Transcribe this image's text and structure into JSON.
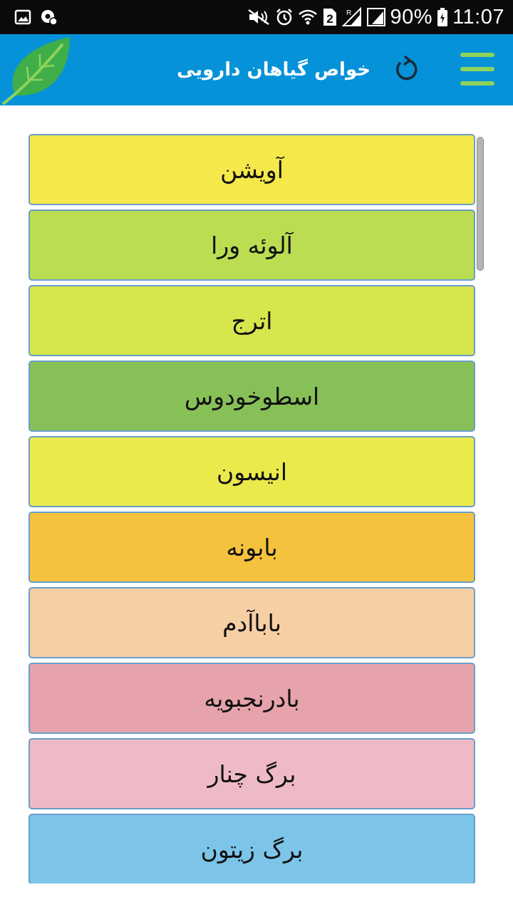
{
  "status_bar": {
    "battery": "90%",
    "time": "11:07",
    "sim": "2"
  },
  "app_bar": {
    "title": "خواص گیاهان دارویی",
    "menu_icon": "hamburger-menu-icon",
    "refresh_icon": "refresh-icon",
    "logo_icon": "leaf-logo-icon",
    "accent": "#0592d8",
    "menu_color": "#8fd35a"
  },
  "plants": [
    {
      "name": "آویشن",
      "color": "#f5e84a"
    },
    {
      "name": "آلوئه ورا",
      "color": "#badd52"
    },
    {
      "name": "اترج",
      "color": "#d6e64c"
    },
    {
      "name": "اسطوخودوس",
      "color": "#88c058"
    },
    {
      "name": "انیسون",
      "color": "#ebea4c"
    },
    {
      "name": "بابونه",
      "color": "#f5c23d"
    },
    {
      "name": "باباآدم",
      "color": "#f7cfa5"
    },
    {
      "name": "بادرنجبویه",
      "color": "#e6a3ab"
    },
    {
      "name": "برگ چنار",
      "color": "#eebac6"
    },
    {
      "name": "برگ زیتون",
      "color": "#7cc5e8"
    }
  ]
}
